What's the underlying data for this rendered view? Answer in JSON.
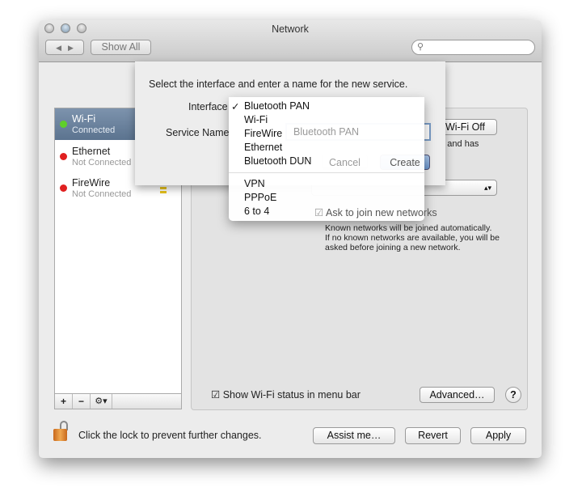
{
  "window": {
    "title": "Network"
  },
  "toolbar": {
    "back": "◀",
    "forward": "▶",
    "show_all": "Show All",
    "search_placeholder": ""
  },
  "services": [
    {
      "name": "Wi-Fi",
      "status": "Connected",
      "color": "#5fcf2a",
      "selected": true
    },
    {
      "name": "Ethernet",
      "status": "Not Connected",
      "color": "#e02020"
    },
    {
      "name": "FireWire",
      "status": "Not Connected",
      "color": "#e02020"
    }
  ],
  "list_controls": {
    "add": "+",
    "remove": "−",
    "gear": "⚙▾"
  },
  "panel": {
    "wifi_off": "Wi-Fi Off",
    "status_fragment": "ne and has",
    "ask_to_join": "Ask to join new networks",
    "ask_desc": [
      "Known networks will be joined automatically.",
      "If no known networks are available, you will be",
      "asked before joining a new network."
    ],
    "show_status": "Show Wi-Fi status in menu bar",
    "advanced": "Advanced…",
    "help": "?"
  },
  "sheet": {
    "prompt": "Select the interface and enter a name for the new service.",
    "interface_label": "Interface",
    "service_name_label": "Service Name",
    "service_name_value": "Bluetooth PAN",
    "cancel": "Cancel",
    "create": "Create"
  },
  "menu": {
    "checked": "✓",
    "items": [
      "Bluetooth PAN",
      "Wi-Fi",
      "FireWire",
      "Ethernet",
      "Bluetooth DUN"
    ],
    "items2": [
      "VPN",
      "PPPoE",
      "6 to 4"
    ]
  },
  "footer": {
    "lock_text": "Click the lock to prevent further changes.",
    "assist": "Assist me…",
    "revert": "Revert",
    "apply": "Apply"
  }
}
